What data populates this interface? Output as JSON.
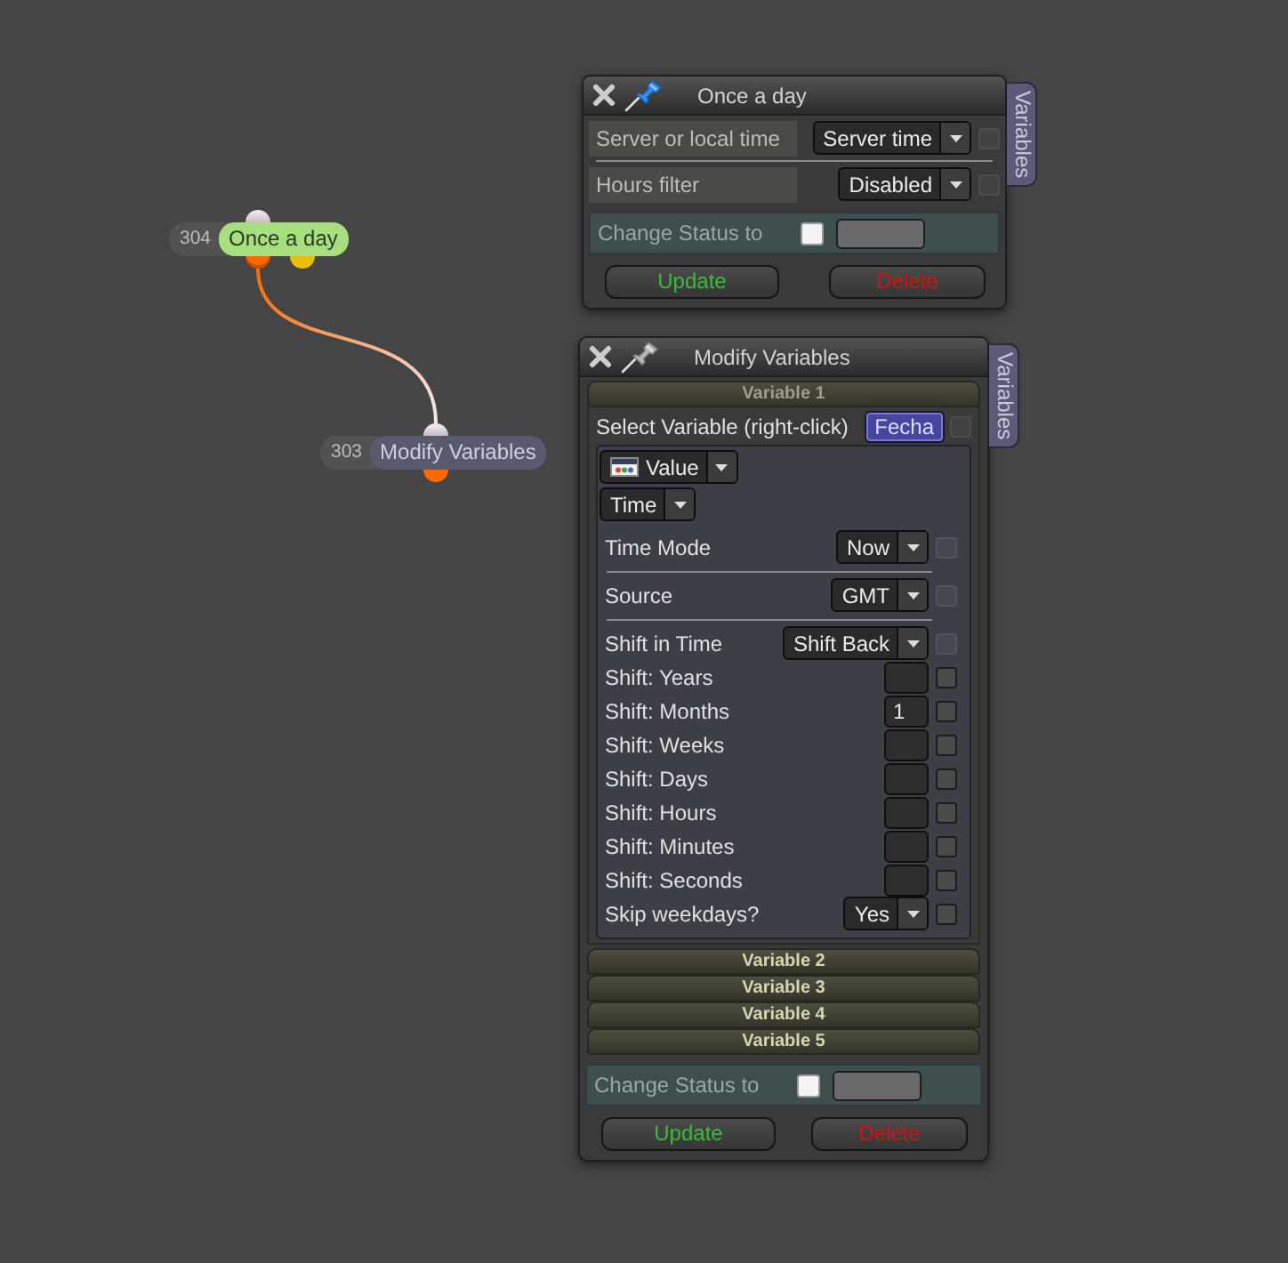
{
  "canvas": {
    "nodes": [
      {
        "number": "304",
        "title": "Once a day",
        "color": "#a8df7e",
        "input_port": true,
        "outputs": [
          {
            "color": "#ff6a00",
            "connected": true
          },
          {
            "color": "#e8c000",
            "connected": false
          }
        ]
      },
      {
        "number": "303",
        "title": "Modify Variables",
        "color": "#5a5a6e",
        "input_port": true,
        "outputs": [
          {
            "color": "#ff6a00",
            "connected": false
          }
        ]
      }
    ]
  },
  "windows": [
    {
      "title": "Once a day",
      "pinned": true,
      "side_tab": "Variables",
      "field_groups": [
        [
          {
            "kind": "select",
            "label": "Server or local time",
            "value": "Server time",
            "checkbox": {
              "checked": false,
              "disabled": true
            }
          }
        ],
        [
          {
            "kind": "select",
            "label": "Hours filter",
            "value": "Disabled",
            "checkbox": {
              "checked": false,
              "disabled": true
            }
          }
        ]
      ],
      "status": {
        "label": "Change Status to",
        "checked": false
      },
      "buttons": [
        {
          "kind": "update",
          "label": "Update"
        },
        {
          "kind": "delete",
          "label": "Delete"
        }
      ]
    },
    {
      "title": "Modify Variables",
      "pinned": false,
      "side_tab": "Variables",
      "variables": [
        {
          "title": "Variable 1",
          "expanded": true,
          "select_label": "Select Variable (right-click)",
          "variable": "Fecha",
          "checkbox": {
            "checked": false,
            "disabled": true
          },
          "source_type": "Value",
          "data_type": "Time",
          "field_groups": [
            [
              {
                "kind": "select",
                "label": "Time Mode",
                "value": "Now",
                "checkbox": {
                  "checked": false,
                  "disabled": true
                }
              }
            ],
            [
              {
                "kind": "select",
                "label": "Source",
                "value": "GMT",
                "checkbox": {
                  "checked": false,
                  "disabled": true
                }
              }
            ],
            [
              {
                "kind": "select",
                "label": "Shift in Time",
                "value": "Shift Back",
                "checkbox": {
                  "checked": false,
                  "disabled": true
                }
              },
              {
                "kind": "number",
                "label": "Shift: Years",
                "checkbox": {
                  "checked": false,
                  "disabled": false
                }
              },
              {
                "kind": "number",
                "label": "Shift: Months",
                "value": "1",
                "checkbox": {
                  "checked": false,
                  "disabled": false
                }
              },
              {
                "kind": "number",
                "label": "Shift: Weeks",
                "checkbox": {
                  "checked": false,
                  "disabled": false
                }
              },
              {
                "kind": "number",
                "label": "Shift: Days",
                "checkbox": {
                  "checked": false,
                  "disabled": false
                }
              },
              {
                "kind": "number",
                "label": "Shift: Hours",
                "checkbox": {
                  "checked": false,
                  "disabled": false
                }
              },
              {
                "kind": "number",
                "label": "Shift: Minutes",
                "checkbox": {
                  "checked": false,
                  "disabled": false
                }
              },
              {
                "kind": "number",
                "label": "Shift: Seconds",
                "checkbox": {
                  "checked": false,
                  "disabled": false
                }
              },
              {
                "kind": "select",
                "label": "Skip weekdays?",
                "value": "Yes",
                "checkbox": {
                  "checked": false,
                  "disabled": false
                }
              }
            ]
          ]
        },
        {
          "title": "Variable 2",
          "expanded": false
        },
        {
          "title": "Variable 3",
          "expanded": false
        },
        {
          "title": "Variable 4",
          "expanded": false
        },
        {
          "title": "Variable 5",
          "expanded": false
        }
      ],
      "status": {
        "label": "Change Status to",
        "checked": false
      },
      "buttons": [
        {
          "kind": "update",
          "label": "Update"
        },
        {
          "kind": "delete",
          "label": "Delete"
        }
      ]
    }
  ]
}
